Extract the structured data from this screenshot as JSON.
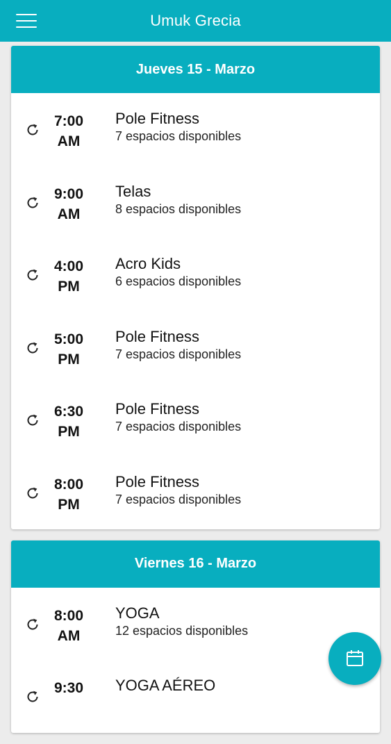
{
  "header": {
    "title": "Umuk Grecia",
    "menu_icon": "hamburger-menu-icon"
  },
  "colors": {
    "accent": "#08aebf",
    "card": "#ffffff",
    "background": "#ececec"
  },
  "days": [
    {
      "title": "Jueves 15 - Marzo",
      "slots": [
        {
          "time_line1": "7:00",
          "time_line2": "AM",
          "class": "Pole Fitness",
          "availability": "7 espacios disponibles"
        },
        {
          "time_line1": "9:00",
          "time_line2": "AM",
          "class": "Telas",
          "availability": "8 espacios disponibles"
        },
        {
          "time_line1": "4:00",
          "time_line2": "PM",
          "class": "Acro Kids",
          "availability": "6 espacios disponibles"
        },
        {
          "time_line1": "5:00",
          "time_line2": "PM",
          "class": "Pole Fitness",
          "availability": "7 espacios disponibles"
        },
        {
          "time_line1": "6:30",
          "time_line2": "PM",
          "class": "Pole Fitness",
          "availability": "7 espacios disponibles"
        },
        {
          "time_line1": "8:00",
          "time_line2": "PM",
          "class": "Pole Fitness",
          "availability": "7 espacios disponibles"
        }
      ]
    },
    {
      "title": "Viernes 16 - Marzo",
      "slots": [
        {
          "time_line1": "8:00",
          "time_line2": "AM",
          "class": "YOGA",
          "availability": "12 espacios disponibles"
        },
        {
          "time_line1": "9:30",
          "time_line2": "",
          "class": "YOGA AÉREO",
          "availability": ""
        }
      ]
    }
  ],
  "fab": {
    "icon": "calendar-icon"
  }
}
